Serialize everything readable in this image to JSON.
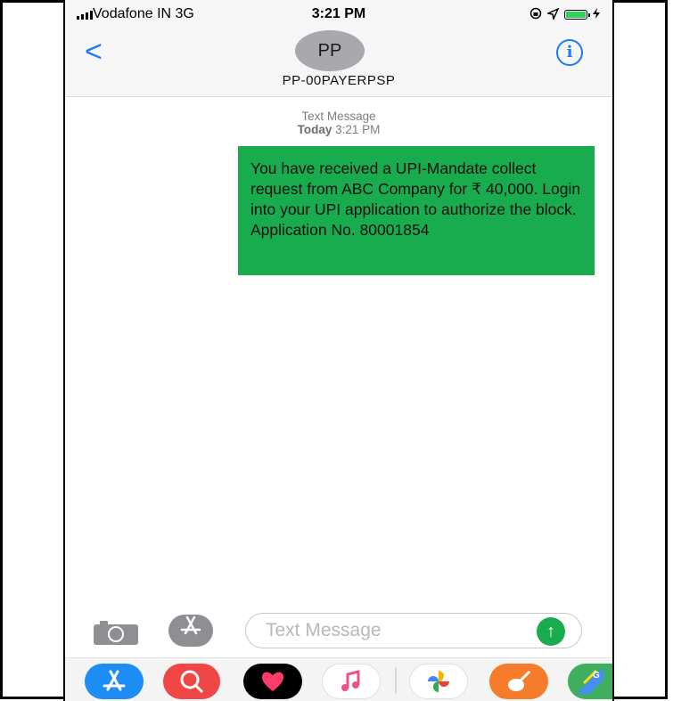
{
  "status_bar": {
    "carrier": "Vodafone IN  3G",
    "time": "3:21 PM",
    "right_icons": [
      "orientation-lock-icon",
      "location-icon",
      "battery-icon",
      "charging-icon"
    ]
  },
  "header": {
    "avatar_initials": "PP",
    "contact_name": "PP-00PAYERPSP",
    "back_icon": "<",
    "info_icon": "i"
  },
  "thread": {
    "label": "Text Message",
    "timestamp_day": "Today",
    "timestamp_time": "3:21 PM",
    "message": "You have received a UPI-Mandate collect request from ABC Company for ₹ 40,000. Login into your UPI application to authorize the block. Application No. 80001854"
  },
  "composer": {
    "placeholder": "Text Message",
    "send_icon": "↑"
  },
  "app_drawer": {
    "apps": [
      "app-store-icon",
      "search-images-icon",
      "digital-touch-icon",
      "music-icon",
      "photos-icon",
      "garageband-icon",
      "maps-icon"
    ]
  },
  "colors": {
    "accent": "#1a7cf5",
    "bubble": "#19ac4f"
  }
}
